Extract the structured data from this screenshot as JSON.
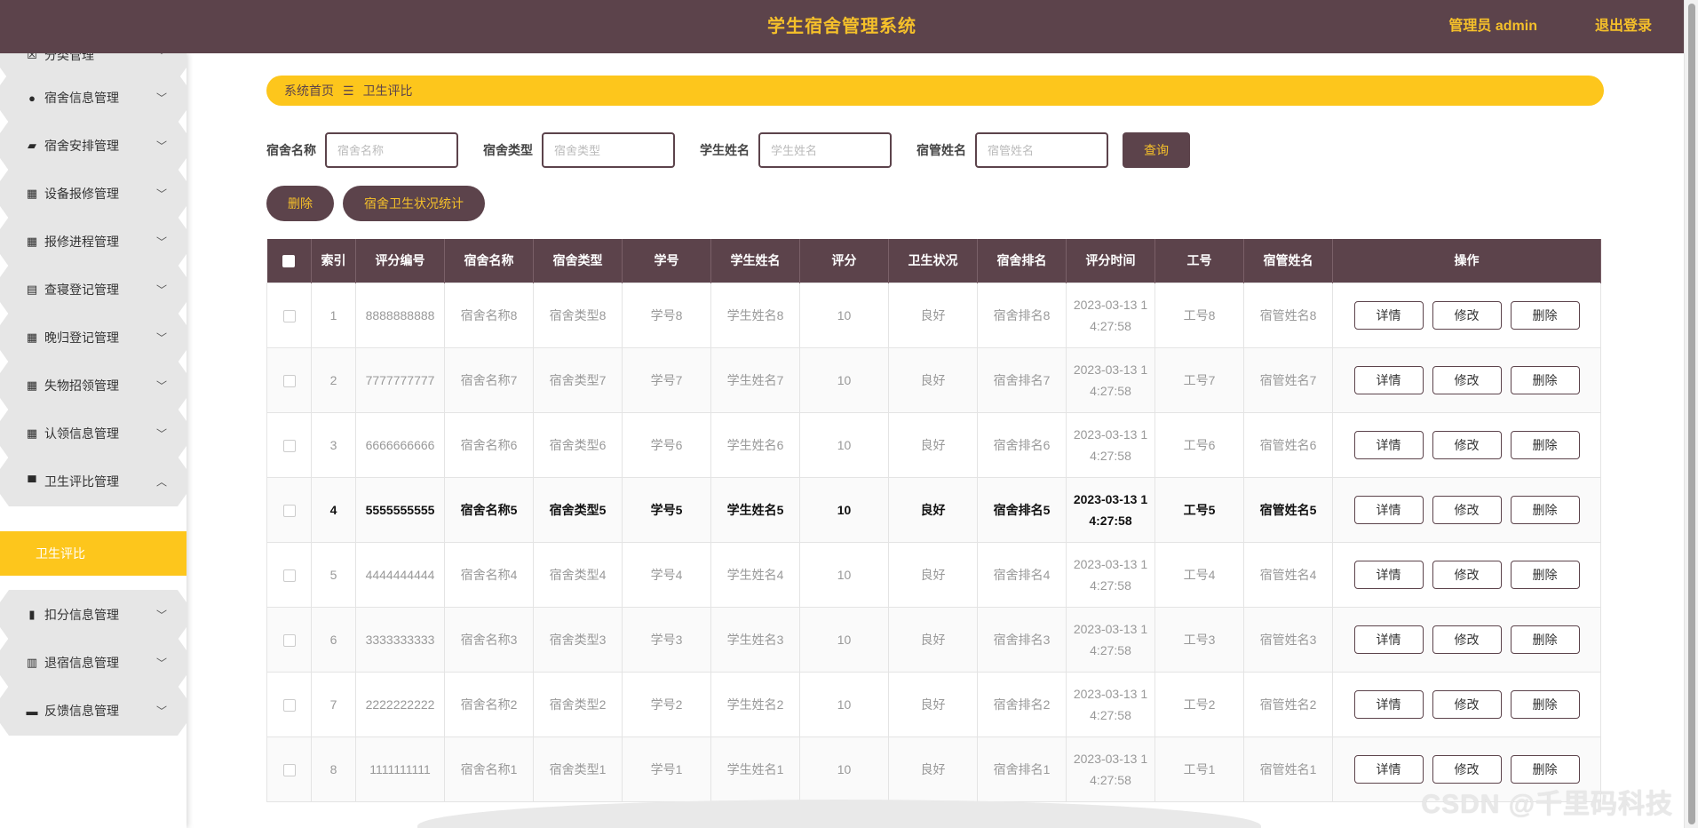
{
  "header": {
    "title": "学生宿舍管理系统",
    "user": "管理员 admin",
    "logout": "退出登录"
  },
  "sidebar": {
    "items": [
      {
        "label": "分类管理",
        "icon": "close-box-icon",
        "glyph": "☒"
      },
      {
        "label": "宿舍信息管理",
        "icon": "pin-icon",
        "glyph": "●"
      },
      {
        "label": "宿舍安排管理",
        "icon": "briefcase-icon",
        "glyph": "▰"
      },
      {
        "label": "设备报修管理",
        "icon": "grid-icon",
        "glyph": "▦"
      },
      {
        "label": "报修进程管理",
        "icon": "grid-icon",
        "glyph": "▦"
      },
      {
        "label": "查寝登记管理",
        "icon": "clipboard-icon",
        "glyph": "▤"
      },
      {
        "label": "晚归登记管理",
        "icon": "grid-icon",
        "glyph": "▦"
      },
      {
        "label": "失物招领管理",
        "icon": "grid-icon",
        "glyph": "▦"
      },
      {
        "label": "认领信息管理",
        "icon": "grid-icon",
        "glyph": "▦"
      },
      {
        "label": "卫生评比管理",
        "icon": "flag-icon",
        "glyph": "▀"
      },
      {
        "label": "扣分信息管理",
        "icon": "bar-chart-icon",
        "glyph": "▮"
      },
      {
        "label": "退宿信息管理",
        "icon": "book-icon",
        "glyph": "▥"
      },
      {
        "label": "反馈信息管理",
        "icon": "edit-icon",
        "glyph": "▬"
      }
    ],
    "active_sub": "卫生评比"
  },
  "breadcrumb": {
    "home": "系统首页",
    "sep": "☰",
    "current": "卫生评比"
  },
  "search": {
    "fields": [
      {
        "label": "宿舍名称",
        "placeholder": "宿舍名称"
      },
      {
        "label": "宿舍类型",
        "placeholder": "宿舍类型"
      },
      {
        "label": "学生姓名",
        "placeholder": "学生姓名"
      },
      {
        "label": "宿管姓名",
        "placeholder": "宿管姓名"
      }
    ],
    "button": "查询"
  },
  "actions": {
    "delete": "删除",
    "stats": "宿舍卫生状况统计"
  },
  "table": {
    "columns": [
      "索引",
      "评分编号",
      "宿舍名称",
      "宿舍类型",
      "学号",
      "学生姓名",
      "评分",
      "卫生状况",
      "宿舍排名",
      "评分时间",
      "工号",
      "宿管姓名",
      "操作"
    ],
    "ops": [
      "详情",
      "修改",
      "删除"
    ],
    "rows": [
      [
        "1",
        "8888888888",
        "宿舍名称8",
        "宿舍类型8",
        "学号8",
        "学生姓名8",
        "10",
        "良好",
        "宿舍排名8",
        "2023-03-13 14:27:58",
        "工号8",
        "宿管姓名8"
      ],
      [
        "2",
        "7777777777",
        "宿舍名称7",
        "宿舍类型7",
        "学号7",
        "学生姓名7",
        "10",
        "良好",
        "宿舍排名7",
        "2023-03-13 14:27:58",
        "工号7",
        "宿管姓名7"
      ],
      [
        "3",
        "6666666666",
        "宿舍名称6",
        "宿舍类型6",
        "学号6",
        "学生姓名6",
        "10",
        "良好",
        "宿舍排名6",
        "2023-03-13 14:27:58",
        "工号6",
        "宿管姓名6"
      ],
      [
        "4",
        "5555555555",
        "宿舍名称5",
        "宿舍类型5",
        "学号5",
        "学生姓名5",
        "10",
        "良好",
        "宿舍排名5",
        "2023-03-13 14:27:58",
        "工号5",
        "宿管姓名5"
      ],
      [
        "5",
        "4444444444",
        "宿舍名称4",
        "宿舍类型4",
        "学号4",
        "学生姓名4",
        "10",
        "良好",
        "宿舍排名4",
        "2023-03-13 14:27:58",
        "工号4",
        "宿管姓名4"
      ],
      [
        "6",
        "3333333333",
        "宿舍名称3",
        "宿舍类型3",
        "学号3",
        "学生姓名3",
        "10",
        "良好",
        "宿舍排名3",
        "2023-03-13 14:27:58",
        "工号3",
        "宿管姓名3"
      ],
      [
        "7",
        "2222222222",
        "宿舍名称2",
        "宿舍类型2",
        "学号2",
        "学生姓名2",
        "10",
        "良好",
        "宿舍排名2",
        "2023-03-13 14:27:58",
        "工号2",
        "宿管姓名2"
      ],
      [
        "8",
        "1111111111",
        "宿舍名称1",
        "宿舍类型1",
        "学号1",
        "学生姓名1",
        "10",
        "良好",
        "宿舍排名1",
        "2023-03-13 14:27:58",
        "工号1",
        "宿管姓名1"
      ]
    ],
    "active_row": 3
  },
  "watermark": "CSDN @千里码科技"
}
